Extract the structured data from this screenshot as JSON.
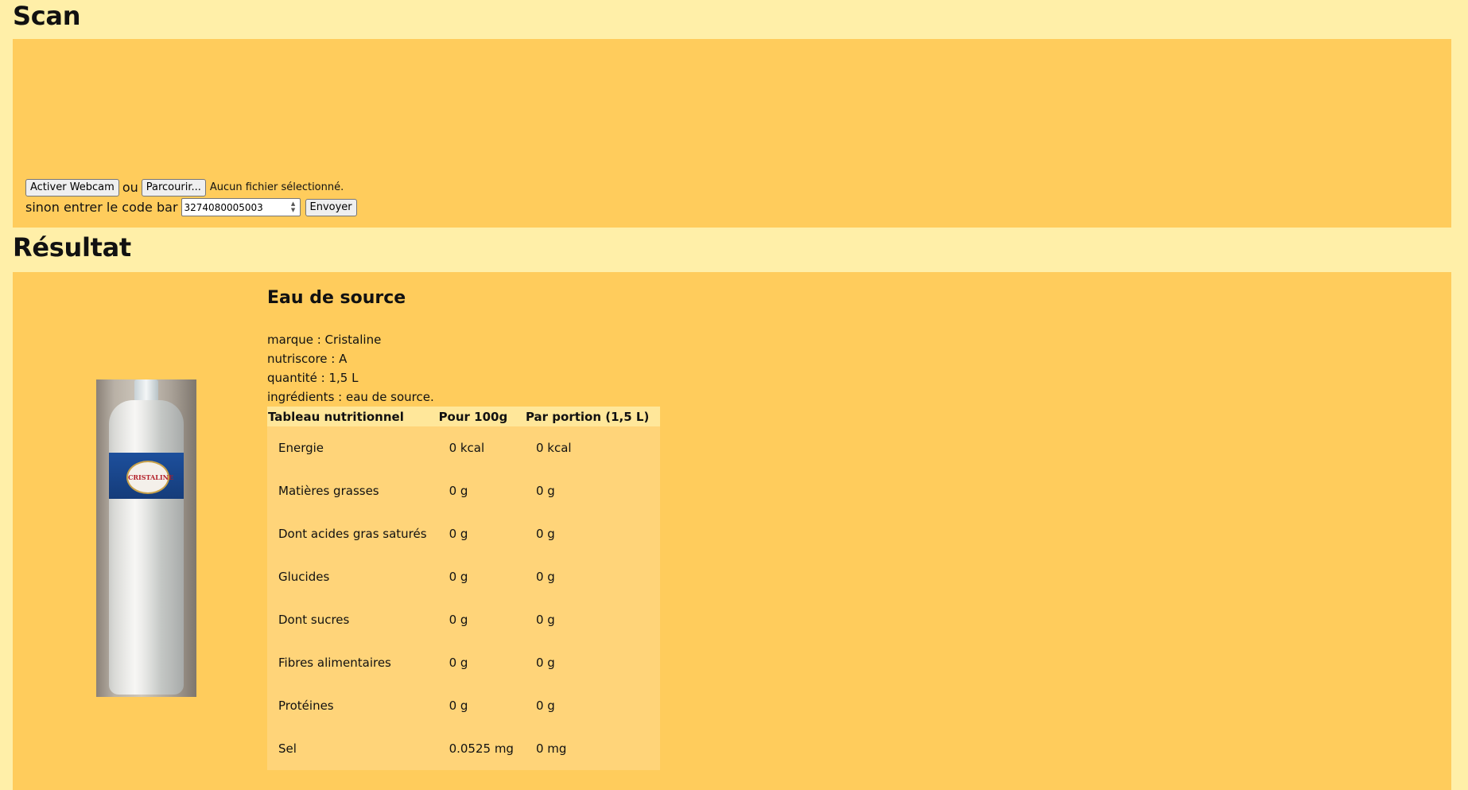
{
  "scan": {
    "heading": "Scan",
    "webcam_button": "Activer Webcam",
    "or_text": "ou",
    "browse_button": "Parcourir...",
    "file_status": "Aucun fichier sélectionné.",
    "barcode_label": "sinon entrer le code bar",
    "barcode_value": "3274080005003",
    "submit_button": "Envoyer"
  },
  "result": {
    "heading": "Résultat",
    "product": {
      "title": "Eau de source",
      "brand": "marque : Cristaline",
      "nutriscore": "nutriscore : A",
      "quantity": "quantité : 1,5 L",
      "ingredients": "ingrédients : eau de source.",
      "image_label": "CRISTALINE"
    },
    "nutrition": {
      "headers": [
        "Tableau nutritionnel",
        "Pour 100g",
        "Par portion (1,5 L)"
      ],
      "rows": [
        [
          "Energie",
          "0 kcal",
          "0 kcal"
        ],
        [
          "Matières grasses",
          "0 g",
          "0 g"
        ],
        [
          "Dont acides gras saturés",
          "0 g",
          "0 g"
        ],
        [
          "Glucides",
          "0 g",
          "0 g"
        ],
        [
          "Dont sucres",
          "0 g",
          "0 g"
        ],
        [
          "Fibres alimentaires",
          "0 g",
          "0 g"
        ],
        [
          "Protéines",
          "0 g",
          "0 g"
        ],
        [
          "Sel",
          "0.0525 mg",
          "0 mg"
        ]
      ]
    }
  },
  "colors": {
    "page_background": "#ffefa8",
    "panel_background": "#ffcc5c",
    "table_background": "#ffd479",
    "table_header_background": "#ffe79a"
  }
}
